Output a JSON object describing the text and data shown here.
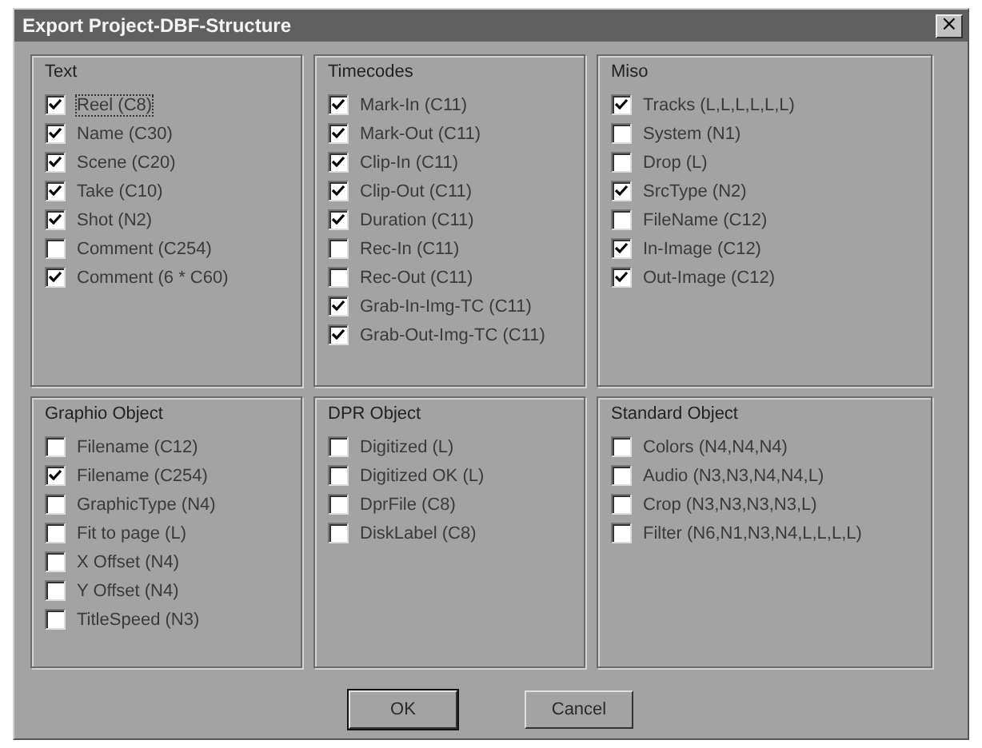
{
  "window": {
    "title": "Export Project-DBF-Structure",
    "close": "×"
  },
  "groups": [
    {
      "title": "Text",
      "items": [
        {
          "label": "Reel (C8)",
          "checked": true,
          "focused": true
        },
        {
          "label": "Name (C30)",
          "checked": true
        },
        {
          "label": "Scene (C20)",
          "checked": true
        },
        {
          "label": "Take (C10)",
          "checked": true
        },
        {
          "label": "Shot (N2)",
          "checked": true
        },
        {
          "label": "Comment (C254)",
          "checked": false
        },
        {
          "label": "Comment (6 * C60)",
          "checked": true
        }
      ]
    },
    {
      "title": "Timecodes",
      "items": [
        {
          "label": "Mark-In (C11)",
          "checked": true
        },
        {
          "label": "Mark-Out (C11)",
          "checked": true
        },
        {
          "label": "Clip-In (C11)",
          "checked": true
        },
        {
          "label": "Clip-Out (C11)",
          "checked": true
        },
        {
          "label": "Duration (C11)",
          "checked": true
        },
        {
          "label": "Rec-In (C11)",
          "checked": false
        },
        {
          "label": "Rec-Out (C11)",
          "checked": false
        },
        {
          "label": "Grab-In-Img-TC (C11)",
          "checked": true
        },
        {
          "label": "Grab-Out-Img-TC (C11)",
          "checked": true
        }
      ]
    },
    {
      "title": "Miso",
      "items": [
        {
          "label": "Tracks (L,L,L,L,L,L)",
          "checked": true
        },
        {
          "label": "System (N1)",
          "checked": false
        },
        {
          "label": "Drop (L)",
          "checked": false
        },
        {
          "label": "SrcType (N2)",
          "checked": true
        },
        {
          "label": "FileName (C12)",
          "checked": false
        },
        {
          "label": "In-Image (C12)",
          "checked": true
        },
        {
          "label": "Out-Image (C12)",
          "checked": true
        }
      ]
    },
    {
      "title": "Graphio Object",
      "items": [
        {
          "label": "Filename (C12)",
          "checked": false
        },
        {
          "label": "Filename (C254)",
          "checked": true
        },
        {
          "label": "GraphicType (N4)",
          "checked": false
        },
        {
          "label": "Fit to page (L)",
          "checked": false
        },
        {
          "label": "X Offset (N4)",
          "checked": false
        },
        {
          "label": "Y Offset (N4)",
          "checked": false
        },
        {
          "label": "TitleSpeed (N3)",
          "checked": false
        }
      ]
    },
    {
      "title": "DPR Object",
      "items": [
        {
          "label": "Digitized (L)",
          "checked": false
        },
        {
          "label": "Digitized OK (L)",
          "checked": false
        },
        {
          "label": "DprFile (C8)",
          "checked": false
        },
        {
          "label": "DiskLabel (C8)",
          "checked": false
        }
      ]
    },
    {
      "title": "Standard Object",
      "items": [
        {
          "label": "Colors (N4,N4,N4)",
          "checked": false
        },
        {
          "label": "Audio (N3,N3,N4,N4,L)",
          "checked": false
        },
        {
          "label": "Crop (N3,N3,N3,N3,L)",
          "checked": false
        },
        {
          "label": "Filter (N6,N1,N3,N4,L,L,L,L)",
          "checked": false
        }
      ]
    }
  ],
  "buttons": [
    {
      "label": "OK",
      "default": true
    },
    {
      "label": "Cancel",
      "default": false
    }
  ]
}
